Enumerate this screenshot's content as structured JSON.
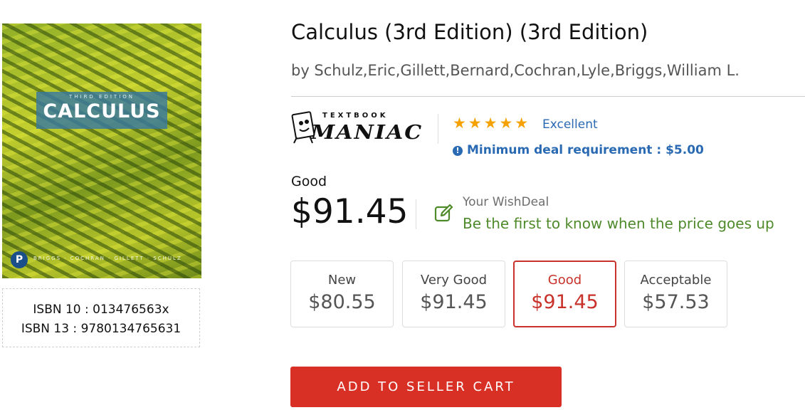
{
  "book": {
    "cover_edition_text": "THIRD EDITION",
    "cover_title_text": "CALCULUS",
    "cover_publisher_logo": "P",
    "cover_authors_text": "BRIGGS · COCHRAN · GILLETT · SCHULZ",
    "isbn10": "ISBN 10 : 013476563x",
    "isbn13": "ISBN 13 : 9780134765631",
    "title": "Calculus (3rd Edition) (3rd Edition)",
    "authors": "by Schulz,Eric,Gillett,Bernard,Cochran,Lyle,Briggs,William L."
  },
  "seller": {
    "logo_top": "TEXTBOOK",
    "logo_main": "MANIAC",
    "stars": "★★★★★",
    "rating_value": 5,
    "rating_label": "Excellent",
    "info_icon": "!",
    "min_deal": "Minimum deal requirement : $5.00"
  },
  "selected": {
    "condition": "Good",
    "price": "$91.45"
  },
  "wishdeal": {
    "title": "Your WishDeal",
    "subtitle": "Be the first to know when the price goes up"
  },
  "options": [
    {
      "name": "New",
      "price": "$80.55"
    },
    {
      "name": "Very Good",
      "price": "$91.45"
    },
    {
      "name": "Good",
      "price": "$91.45"
    },
    {
      "name": "Acceptable",
      "price": "$57.53"
    }
  ],
  "cart_button": "ADD TO SELLER CART",
  "colors": {
    "accent_red": "#d93026",
    "link_blue": "#2a6ab3",
    "star_orange": "#f5a100",
    "wish_green": "#4f8a2a"
  }
}
